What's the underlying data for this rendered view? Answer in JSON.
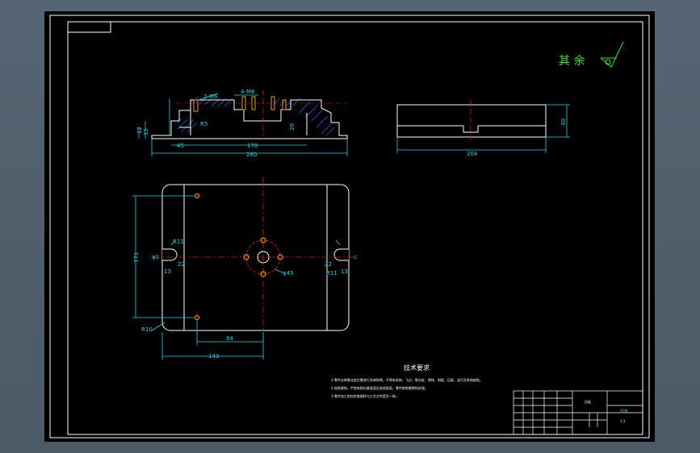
{
  "colors": {
    "background": "#000000",
    "viewport_frame": "#566573",
    "geometry": "#ffffff",
    "dimension": "#19d7ee",
    "centerline": "#e0161b",
    "hatch": "#1a5fe6",
    "surface_symbol": "#2ee52e",
    "hole": "#e8a000"
  },
  "roughness_note": "其 余",
  "section_view": {
    "dims": {
      "overall_width": "280",
      "inner_width": "170",
      "left_offset": "45",
      "thread": "2-M6",
      "thread2": "4-M8",
      "radius_inner": "R5",
      "height_left": "12",
      "height_step": "15",
      "depth": "20"
    }
  },
  "side_view": {
    "dims": {
      "width": "204",
      "height": "40"
    }
  },
  "plan_view": {
    "dims": {
      "height": "171",
      "half_width": "94",
      "offset": "143",
      "radius_slot_left": "R11",
      "radius_slot_right": "R11",
      "radius_corner": "R10",
      "slot_left": "13",
      "slot_right": "13",
      "slot_width_left": "22",
      "slot_width_right": "22",
      "hole_dia": "φ45",
      "edge_left": "φ1",
      "edge_right": "c"
    }
  },
  "tech_req": {
    "title": "技术要求",
    "lines": [
      "1.零件去除氧化皮后需进行涂漆防锈，不得有毛刺、飞边、氧化皮、锈蚀、划痕、压痕、油污及其他缺陷。",
      "2.锐角倒钝，严禁有损伤基准面及其他表面，零件棱角需倒钝处理。",
      "3.零件加工前应检查图样与工艺文件是否一致。"
    ]
  },
  "title_block": {
    "name": "压板",
    "material": "45钢",
    "scale": "1:1"
  }
}
